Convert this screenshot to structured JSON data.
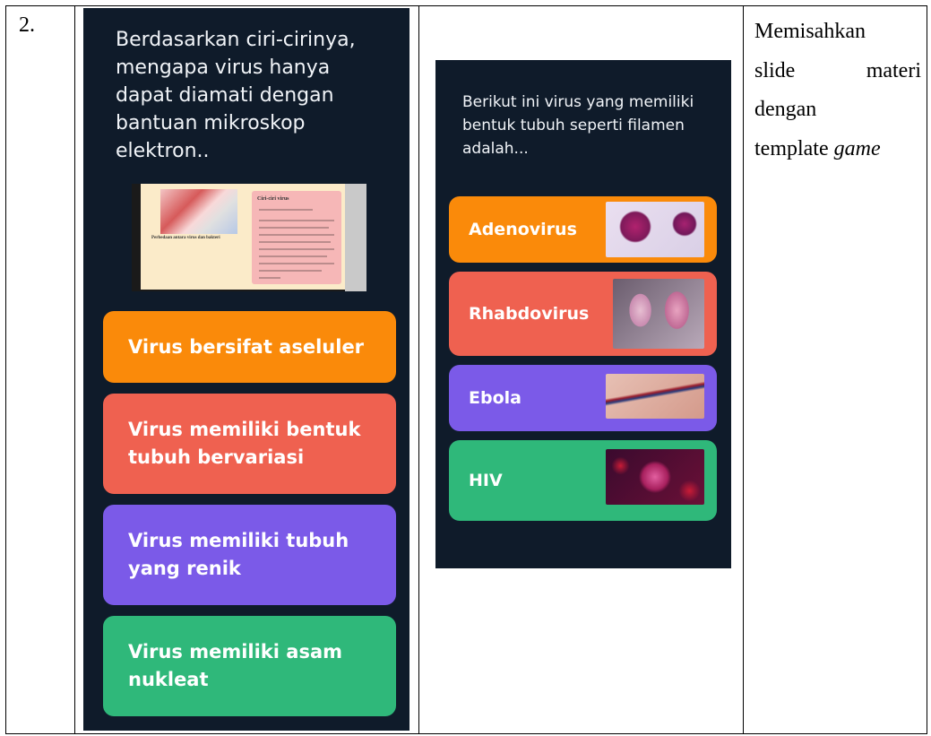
{
  "row_number": "2.",
  "left_slide": {
    "question": "Berdasarkan ciri-cirinya, mengapa virus hanya dapat diamati dengan bantuan mikroskop elektron..",
    "material": {
      "caption": "Perbedaan antara virus dan bakteri",
      "box_title": "Ciri-ciri virus"
    },
    "options": [
      {
        "label": "Virus bersifat aseluler",
        "color": "#fa8a0a"
      },
      {
        "label": "Virus memiliki bentuk tubuh bervariasi",
        "color": "#ef6150"
      },
      {
        "label": "Virus memiliki tubuh yang renik",
        "color": "#7b5ae8"
      },
      {
        "label": "Virus memiliki asam nukleat",
        "color": "#2fb87a"
      }
    ]
  },
  "right_slide": {
    "question": "Berikut ini virus yang memiliki bentuk tubuh seperti filamen adalah...",
    "options": [
      {
        "label": "Adenovirus",
        "color": "#fa8a0a",
        "icon": "adenovirus-image"
      },
      {
        "label": "Rhabdovirus",
        "color": "#ef6150",
        "icon": "rhabdovirus-image"
      },
      {
        "label": "Ebola",
        "color": "#7b5ae8",
        "icon": "ebola-image"
      },
      {
        "label": "HIV",
        "color": "#2fb87a",
        "icon": "hiv-image"
      }
    ]
  },
  "description": {
    "lines": [
      [
        "Memisahkan"
      ],
      [
        "slide",
        "materi"
      ],
      [
        "dengan"
      ]
    ],
    "last_line_text": "template ",
    "last_line_emphasis": "game"
  },
  "theme": {
    "slide_background": "#0f1b2a",
    "text": "#f1f4f8"
  }
}
